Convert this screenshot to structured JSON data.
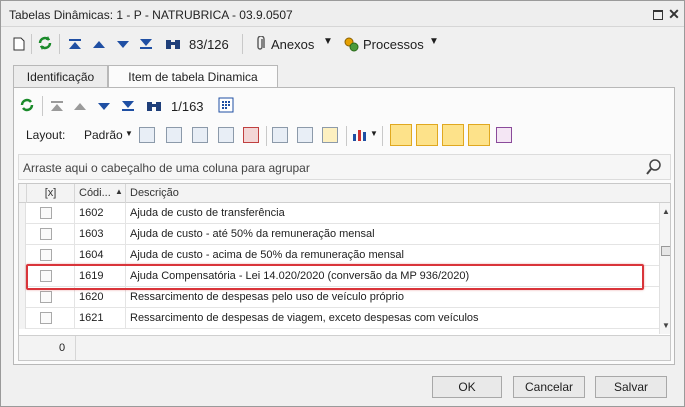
{
  "window": {
    "title": "Tabelas Dinâmicas: 1 - P - NATRUBRICA - 03.9.0507"
  },
  "toolbar": {
    "record_counter": "83/126",
    "attachments_label": "Anexos",
    "processes_label": "Processos"
  },
  "tabs": [
    {
      "label": "Identificação"
    },
    {
      "label": "Item de tabela Dinamica"
    }
  ],
  "subtoolbar": {
    "record_counter": "1/163",
    "layout_label": "Layout:",
    "layout_value": "Padrão"
  },
  "grid": {
    "group_hint": "Arraste aqui o cabeçalho de uma coluna para agrupar",
    "columns": [
      "[x]",
      "Códi...",
      "Descrição"
    ],
    "rows": [
      {
        "code": "1602",
        "description": "Ajuda de custo de transferência"
      },
      {
        "code": "1603",
        "description": "Ajuda de custo - até 50% da remuneração mensal"
      },
      {
        "code": "1604",
        "description": "Ajuda de custo - acima de 50% da remuneração mensal"
      },
      {
        "code": "1619",
        "description": "Ajuda Compensatória - Lei 14.020/2020 (conversão da MP 936/2020)"
      },
      {
        "code": "1620",
        "description": "Ressarcimento de despesas pelo uso de veículo próprio"
      },
      {
        "code": "1621",
        "description": "Ressarcimento de despesas de viagem, exceto despesas com veículos"
      }
    ],
    "footer_count": "0"
  },
  "buttons": {
    "ok": "OK",
    "cancel": "Cancelar",
    "save": "Salvar"
  },
  "colors": {
    "highlight": "#d9343a",
    "accent": "#1f4fa3"
  }
}
